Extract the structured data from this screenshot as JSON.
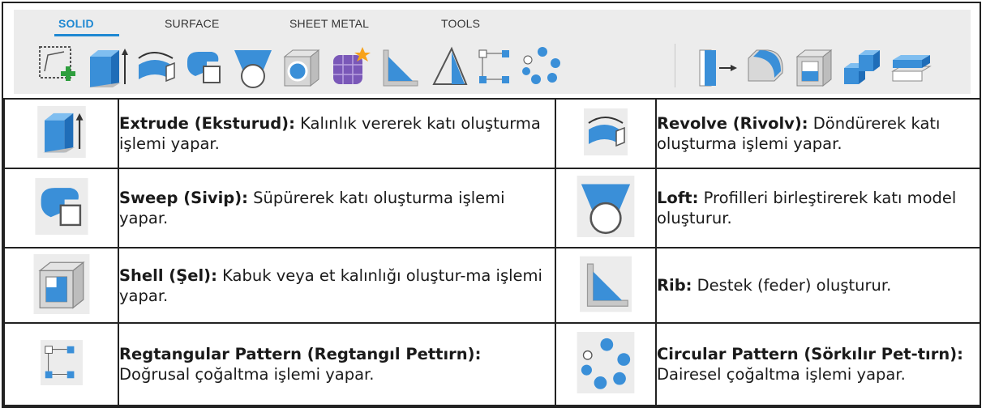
{
  "toolbar": {
    "tabs": [
      {
        "label": "SOLID",
        "active": true
      },
      {
        "label": "SURFACE",
        "active": false
      },
      {
        "label": "SHEET METAL",
        "active": false
      },
      {
        "label": "TOOLS",
        "active": false
      }
    ],
    "icons": [
      "new-sketch-icon",
      "extrude-icon",
      "revolve-icon",
      "sweep-icon",
      "loft-icon",
      "shell-icon",
      "create-form-icon",
      "rib-icon",
      "web-icon",
      "rectangular-pattern-icon",
      "circular-pattern-icon",
      "press-pull-icon",
      "fillet-icon",
      "shell-tool-icon",
      "combine-icon",
      "thicken-icon"
    ]
  },
  "rows": [
    {
      "left": {
        "icon": "extrude-icon",
        "term": "Extrude (Eksturud):",
        "desc": " Kalınlık vererek katı oluşturma işlemi yapar."
      },
      "right": {
        "icon": "revolve-icon",
        "term": "Revolve (Rivolv):",
        "desc": " Döndürerek katı oluşturma işlemi yapar."
      }
    },
    {
      "left": {
        "icon": "sweep-icon",
        "term": "Sweep (Sivip):",
        "desc": " Süpürerek katı oluşturma işlemi yapar."
      },
      "right": {
        "icon": "loft-icon",
        "term": "Loft:",
        "desc": " Profilleri birleştirerek katı model oluşturur."
      }
    },
    {
      "left": {
        "icon": "shell-icon",
        "term": "Shell (Şel):",
        "desc": " Kabuk veya et kalınlığı oluştur-ma işlemi yapar."
      },
      "right": {
        "icon": "rib-icon",
        "term": "Rib:",
        "desc": " Destek (feder) oluşturur."
      }
    },
    {
      "left": {
        "icon": "rectangular-pattern-icon",
        "term": "Regtangular Pattern (Regtangıl Pettırn):",
        "desc": " Doğrusal çoğaltma işlemi yapar."
      },
      "right": {
        "icon": "circular-pattern-icon",
        "term": "Circular Pattern (Sörkılır Pet-tırn):",
        "desc": " Dairesel çoğaltma işlemi yapar."
      }
    }
  ],
  "colors": {
    "accent": "#1e88d2",
    "icon_blue": "#3a8fd8",
    "toolbar_bg": "#ececec"
  }
}
